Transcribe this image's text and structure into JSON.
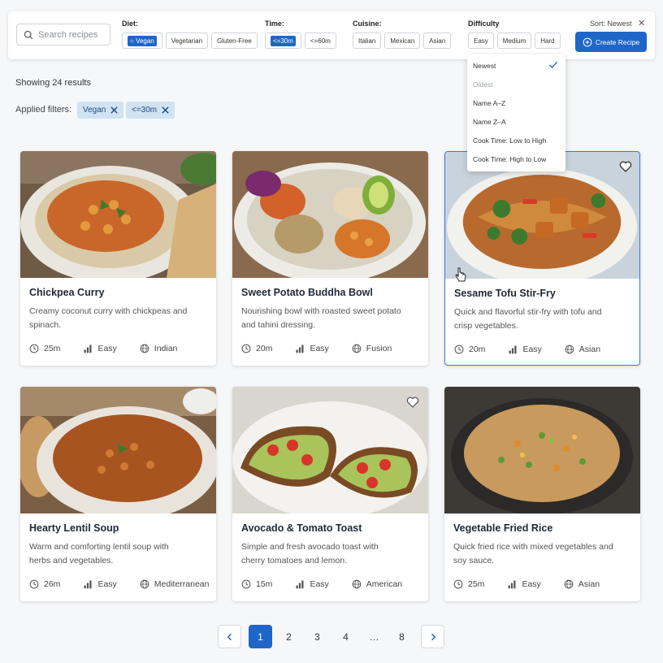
{
  "toolbar": {
    "search_placeholder": "Search recipes",
    "diet_label": "Diet:",
    "diet_options": [
      "Vegan",
      "Vegetarian",
      "Gluten-Free"
    ],
    "time_label": "Time:",
    "time_options": [
      "<=30m",
      "<=60m"
    ],
    "cuisine_label": "Cuisine:",
    "cuisine_options": [
      "Italian",
      "Mexican",
      "Asian"
    ],
    "difficulty_label": "Difficulty",
    "difficulty_options": [
      "Easy",
      "Medium",
      "Hard"
    ],
    "sort_label": "Sort: Newest",
    "close_label": "✕",
    "create_label": "Create Recipe",
    "accent": "#1f66c8"
  },
  "sort_menu": {
    "items": [
      "Newest",
      "Oldest",
      "Name A–Z",
      "Name Z–A",
      "Cook Time: Low to High",
      "Cook Time: High to Low"
    ],
    "selected": "Newest"
  },
  "summary": {
    "results": "Showing 24 results",
    "applied_label": "Applied filters:",
    "applied": [
      "Vegan",
      "<=30m"
    ]
  },
  "recipes": [
    {
      "title": "Chickpea Curry",
      "desc": "Creamy coconut curry with chickpeas and spinach.",
      "time": "25m",
      "difficulty": "Easy",
      "cuisine": "Indian"
    },
    {
      "title": "Sweet Potato Buddha Bowl",
      "desc": "Nourishing bowl with roasted sweet potato and tahini dressing.",
      "time": "20m",
      "difficulty": "Easy",
      "cuisine": "Fusion"
    },
    {
      "title": "Sesame Tofu Stir-Fry",
      "desc": "Quick and flavorful stir-fry with tofu and crisp vegetables.",
      "time": "20m",
      "difficulty": "Easy",
      "cuisine": "Asian"
    },
    {
      "title": "Hearty Lentil Soup",
      "desc": "Warm and comforting lentil soup with herbs and vegetables.",
      "time": "26m",
      "difficulty": "Easy",
      "cuisine": "Mediterranean"
    },
    {
      "title": "Avocado & Tomato Toast",
      "desc": "Simple and fresh avocado toast with cherry tomatoes and lemon.",
      "time": "15m",
      "difficulty": "Easy",
      "cuisine": "American"
    },
    {
      "title": "Vegetable Fried Rice",
      "desc": "Quick fried rice with mixed vegetables and soy sauce.",
      "time": "25m",
      "difficulty": "Easy",
      "cuisine": "Asian"
    }
  ],
  "pagination": {
    "pages": [
      "1",
      "2",
      "3",
      "4",
      "…",
      "8"
    ],
    "current": "1"
  }
}
